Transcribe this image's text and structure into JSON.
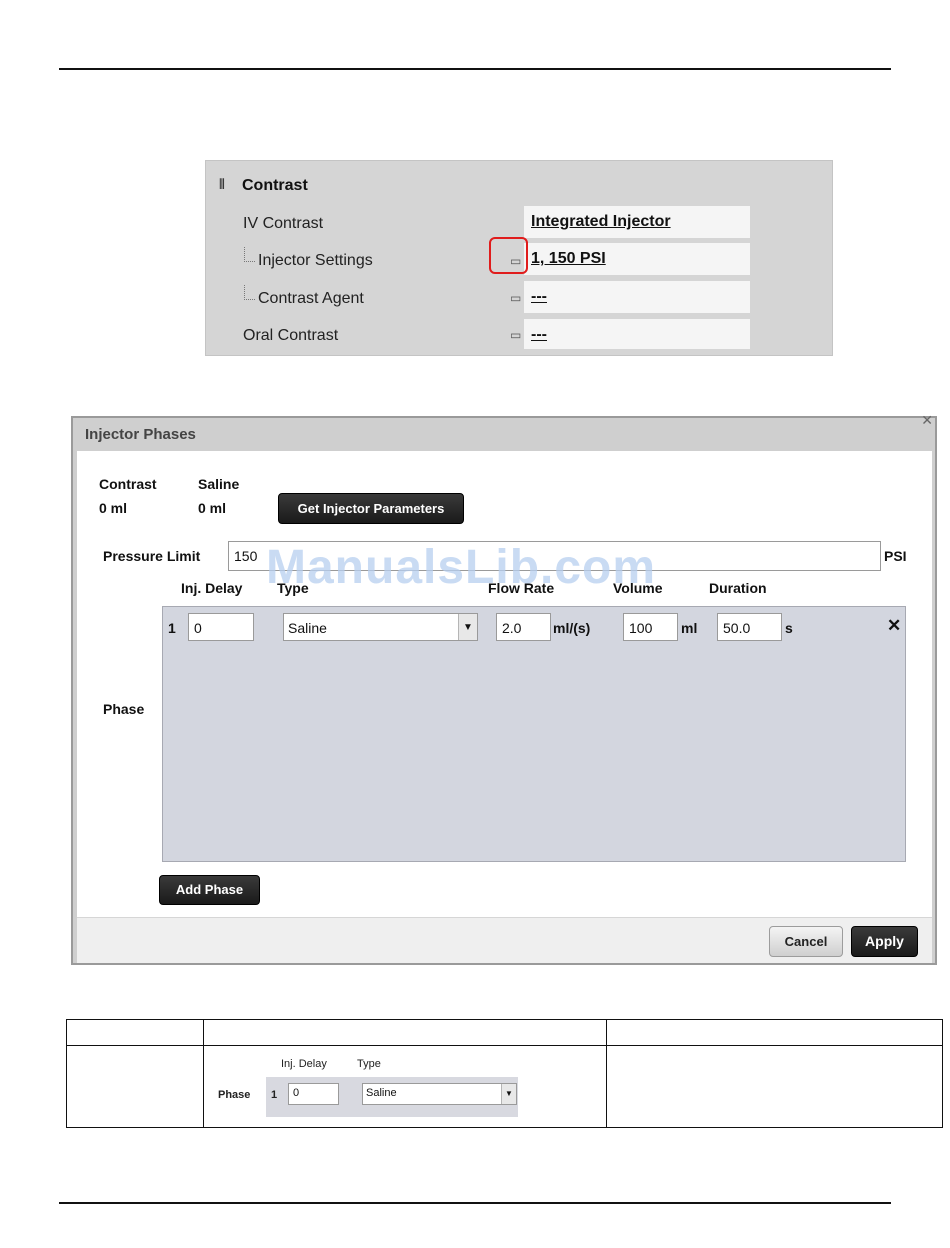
{
  "contrast_panel": {
    "title": "Contrast",
    "rows": [
      {
        "label": "IV Contrast",
        "value": "Integrated Injector",
        "note": ""
      },
      {
        "label": "Injector Settings",
        "value": "1, 150 PSI",
        "note": "▭"
      },
      {
        "label": "Contrast Agent",
        "value": "---",
        "note": "▭"
      },
      {
        "label": "Oral Contrast",
        "value": "---",
        "note": "▭"
      }
    ]
  },
  "dialog": {
    "title": "Injector Phases",
    "contrast_label": "Contrast",
    "contrast_value": "0 ml",
    "saline_label": "Saline",
    "saline_value": "0 ml",
    "get_params_button": "Get Injector Parameters",
    "pressure_label": "Pressure Limit",
    "pressure_value": "150",
    "pressure_unit": "PSI",
    "columns": {
      "inj_delay": "Inj. Delay",
      "type": "Type",
      "flow_rate": "Flow Rate",
      "volume": "Volume",
      "duration": "Duration"
    },
    "phase_label": "Phase",
    "phase_rows": [
      {
        "index": "1",
        "inj_delay": "0",
        "type": "Saline",
        "flow_rate": "2.0",
        "flow_unit": "ml/(s)",
        "volume": "100",
        "volume_unit": "ml",
        "duration": "50.0",
        "duration_unit": "s"
      }
    ],
    "add_phase_button": "Add Phase",
    "cancel_button": "Cancel",
    "apply_button": "Apply"
  },
  "watermark": "ManualsLib.com",
  "table_mini": {
    "inj_delay": "Inj. Delay",
    "type": "Type",
    "phase": "Phase",
    "index": "1",
    "delay_value": "0",
    "type_value": "Saline"
  }
}
